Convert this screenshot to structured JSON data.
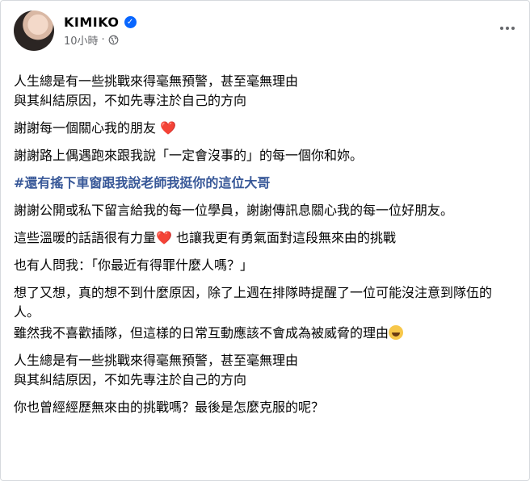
{
  "post": {
    "author": "KIMIKO",
    "verified_icon": "verified-badge-icon",
    "time": "10小時",
    "separator": "·",
    "audience_icon": "globe-icon",
    "more_icon": "more-options-icon"
  },
  "content": {
    "p1_line1": "人生總是有一些挑戰來得毫無預警，甚至毫無理由",
    "p1_line2": "與其糾結原因，不如先專注於自己的方向",
    "p2": "謝謝每一個關心我的朋友",
    "p2_emoji": "❤️",
    "p3": "謝謝路上偶遇跑來跟我說「一定會沒事的」的每一個你和妳。",
    "hashtag": "#還有搖下車窗跟我說老師我挺你的這位大哥",
    "p4": "謝謝公開或私下留言給我的每一位學員，謝謝傳訊息關心我的每一位好朋友。",
    "p5_part1": "這些溫暖的話語很有力量",
    "p5_emoji": "❤️",
    "p5_part2": "也讓我更有勇氣面對這段無來由的挑戰",
    "p6": "也有人問我：「你最近有得罪什麼人嗎？」",
    "p7": "想了又想，真的想不到什麼原因，除了上週在排隊時提醒了一位可能沒注意到隊伍的人。",
    "p8": "雖然我不喜歡插隊，但這樣的日常互動應該不會成為被威脅的理由",
    "p8_emoji": "😅",
    "p9_line1": "人生總是有一些挑戰來得毫無預警，甚至毫無理由",
    "p9_line2": "與其糾結原因，不如先專注於自己的方向",
    "p10": "你也曾經經歷無來由的挑戰嗎？最後是怎麼克服的呢？"
  }
}
